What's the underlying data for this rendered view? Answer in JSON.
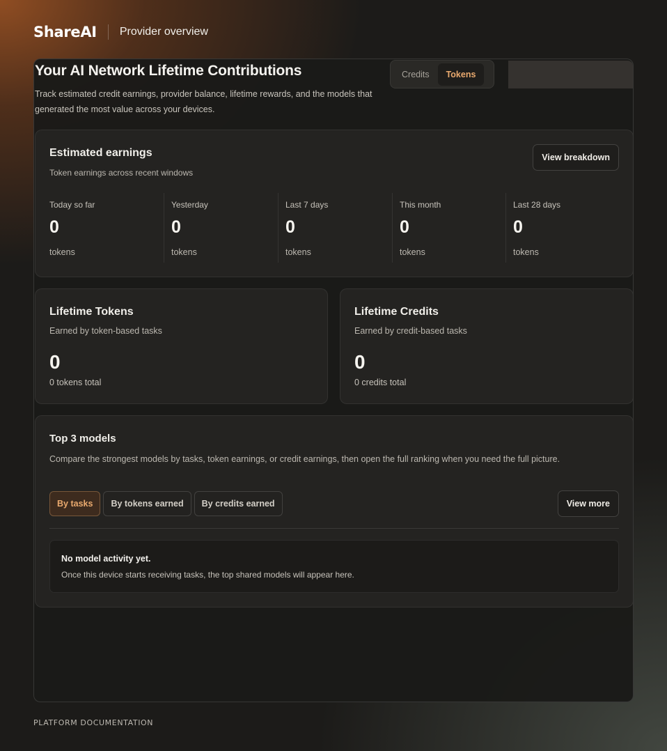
{
  "header": {
    "brand": "ShareAI",
    "page_label": "Provider overview"
  },
  "overview": {
    "title": "Your AI Network Lifetime Contributions",
    "description": "Track estimated credit earnings, provider balance, lifetime rewards, and the models that generated the most value across your devices.",
    "toggle": {
      "options": [
        "Credits",
        "Tokens"
      ],
      "selected": "Tokens"
    }
  },
  "estimated_earnings": {
    "title": "Estimated earnings",
    "subtitle": "Token earnings across recent windows",
    "button_label": "View breakdown",
    "stats": [
      {
        "label": "Today so far",
        "value": "0",
        "unit": "tokens"
      },
      {
        "label": "Yesterday",
        "value": "0",
        "unit": "tokens"
      },
      {
        "label": "Last 7 days",
        "value": "0",
        "unit": "tokens"
      },
      {
        "label": "This month",
        "value": "0",
        "unit": "tokens"
      },
      {
        "label": "Last 28 days",
        "value": "0",
        "unit": "tokens"
      }
    ]
  },
  "lifetime_tokens": {
    "title": "Lifetime Tokens",
    "subtitle": "Earned by token-based tasks",
    "value": "0",
    "total": "0 tokens total"
  },
  "lifetime_credits": {
    "title": "Lifetime Credits",
    "subtitle": "Earned by credit-based tasks",
    "value": "0",
    "total": "0 credits total"
  },
  "top_models": {
    "title": "Top 3 models",
    "description": "Compare the strongest models by tasks, token earnings, or credit earnings, then open the full ranking when you need the full picture.",
    "filters": [
      "By tasks",
      "By tokens earned",
      "By credits earned"
    ],
    "selected_filter": "By tasks",
    "view_more_label": "View more",
    "empty_title": "No model activity yet.",
    "empty_description": "Once this device starts receiving tasks, the top shared models will appear here."
  },
  "footer": {
    "link": "PLATFORM DOCUMENTATION"
  },
  "colors": {
    "accent": "#e9a96e",
    "background": "#1c1b19",
    "card": "#242321"
  }
}
